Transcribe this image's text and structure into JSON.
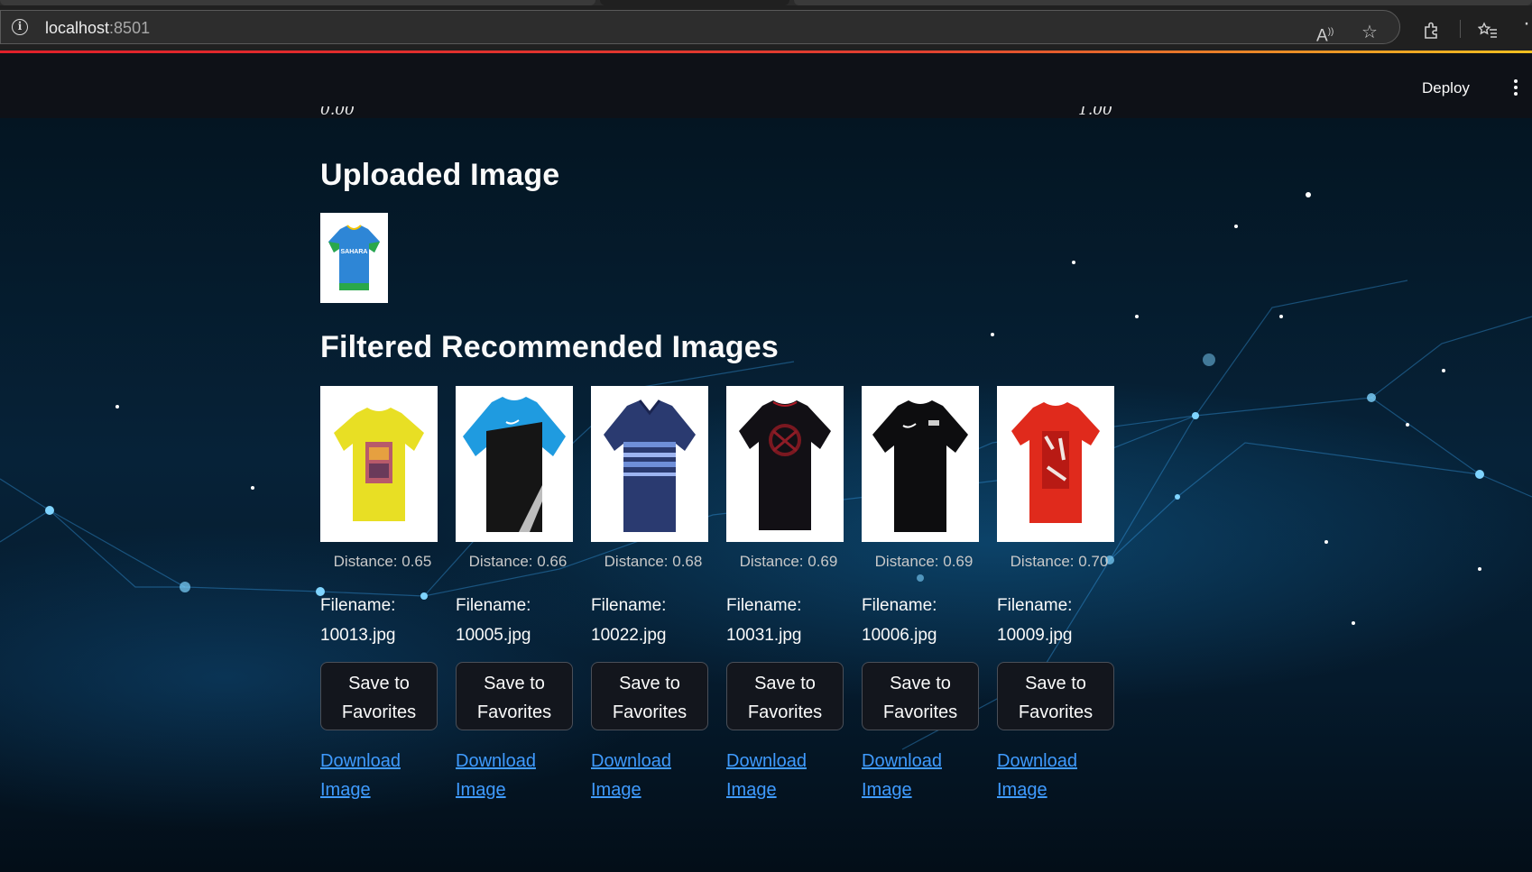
{
  "browser": {
    "url_host": "localhost",
    "url_port": ":8501"
  },
  "header": {
    "deploy_label": "Deploy"
  },
  "slider": {
    "min_label": "0.00",
    "max_label": "1.00"
  },
  "uploaded": {
    "title": "Uploaded Image",
    "shirt_text": "SAHARA"
  },
  "recommended": {
    "title": "Filtered Recommended Images",
    "items": [
      {
        "distance": "Distance: 0.65",
        "filename_label": "Filename:",
        "filename": "10013.jpg",
        "save_label_1": "Save to",
        "save_label_2": "Favorites",
        "download_1": "Download",
        "download_2": "Image"
      },
      {
        "distance": "Distance: 0.66",
        "filename_label": "Filename:",
        "filename": "10005.jpg",
        "save_label_1": "Save to",
        "save_label_2": "Favorites",
        "download_1": "Download",
        "download_2": "Image"
      },
      {
        "distance": "Distance: 0.68",
        "filename_label": "Filename:",
        "filename": "10022.jpg",
        "save_label_1": "Save to",
        "save_label_2": "Favorites",
        "download_1": "Download",
        "download_2": "Image"
      },
      {
        "distance": "Distance: 0.69",
        "filename_label": "Filename:",
        "filename": "10031.jpg",
        "save_label_1": "Save to",
        "save_label_2": "Favorites",
        "download_1": "Download",
        "download_2": "Image"
      },
      {
        "distance": "Distance: 0.69",
        "filename_label": "Filename:",
        "filename": "10006.jpg",
        "save_label_1": "Save to",
        "save_label_2": "Favorites",
        "download_1": "Download",
        "download_2": "Image"
      },
      {
        "distance": "Distance: 0.70",
        "filename_label": "Filename:",
        "filename": "10009.jpg",
        "save_label_1": "Save to",
        "save_label_2": "Favorites",
        "download_1": "Download",
        "download_2": "Image"
      }
    ]
  },
  "colors": {
    "link": "#3f9bff",
    "header_bg": "#0e1117",
    "accent_loadbar": "#e0202a"
  }
}
